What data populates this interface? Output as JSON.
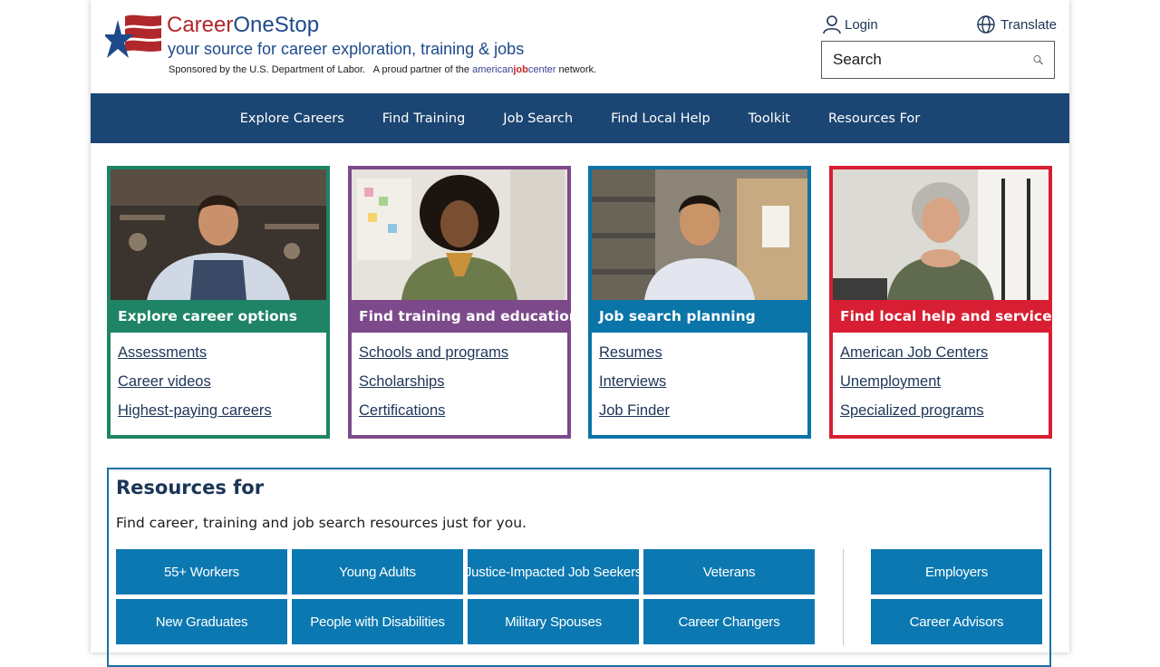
{
  "header": {
    "brand_part1": "Career",
    "brand_part2": "OneStop",
    "tagline": "your source for career exploration, training & jobs",
    "sponsor_text": "Sponsored by the U.S. Department of Labor.",
    "partner_text": "A proud partner of the",
    "ajc_part1": "american",
    "ajc_part2": "job",
    "ajc_part3": "center",
    "partner_suffix": "network.",
    "login_label": "Login",
    "translate_label": "Translate",
    "search_placeholder": "Search"
  },
  "nav": {
    "items": [
      "Explore Careers",
      "Find Training",
      "Job Search",
      "Find Local Help",
      "Toolkit",
      "Resources For"
    ]
  },
  "cards": [
    {
      "title": "Explore career options",
      "color": "#1f8466",
      "links": [
        "Assessments",
        "Career videos",
        "Highest-paying careers"
      ]
    },
    {
      "title": "Find training and education",
      "color": "#7c4a8a",
      "links": [
        "Schools and programs",
        "Scholarships",
        "Certifications"
      ]
    },
    {
      "title": "Job search planning",
      "color": "#0b74a8",
      "links": [
        "Resumes",
        "Interviews",
        "Job Finder"
      ]
    },
    {
      "title": "Find local help and services",
      "color": "#d81e33",
      "links": [
        "American Job Centers",
        "Unemployment",
        "Specialized programs"
      ]
    }
  ],
  "resources": {
    "heading": "Resources for",
    "description": "Find career, training and job search resources just for you.",
    "buttons": [
      "55+ Workers",
      "Young Adults",
      "Justice-Impacted Job Seekers",
      "Veterans",
      "New Graduates",
      "People with Disabilities",
      "Military Spouses",
      "Career Changers"
    ],
    "side_buttons": [
      "Employers",
      "Career Advisors"
    ]
  },
  "colors": {
    "nav_bg": "#1b4572",
    "button_bg": "#0b78b1",
    "brand_red": "#b0272c",
    "brand_blue": "#1d4a8a"
  }
}
